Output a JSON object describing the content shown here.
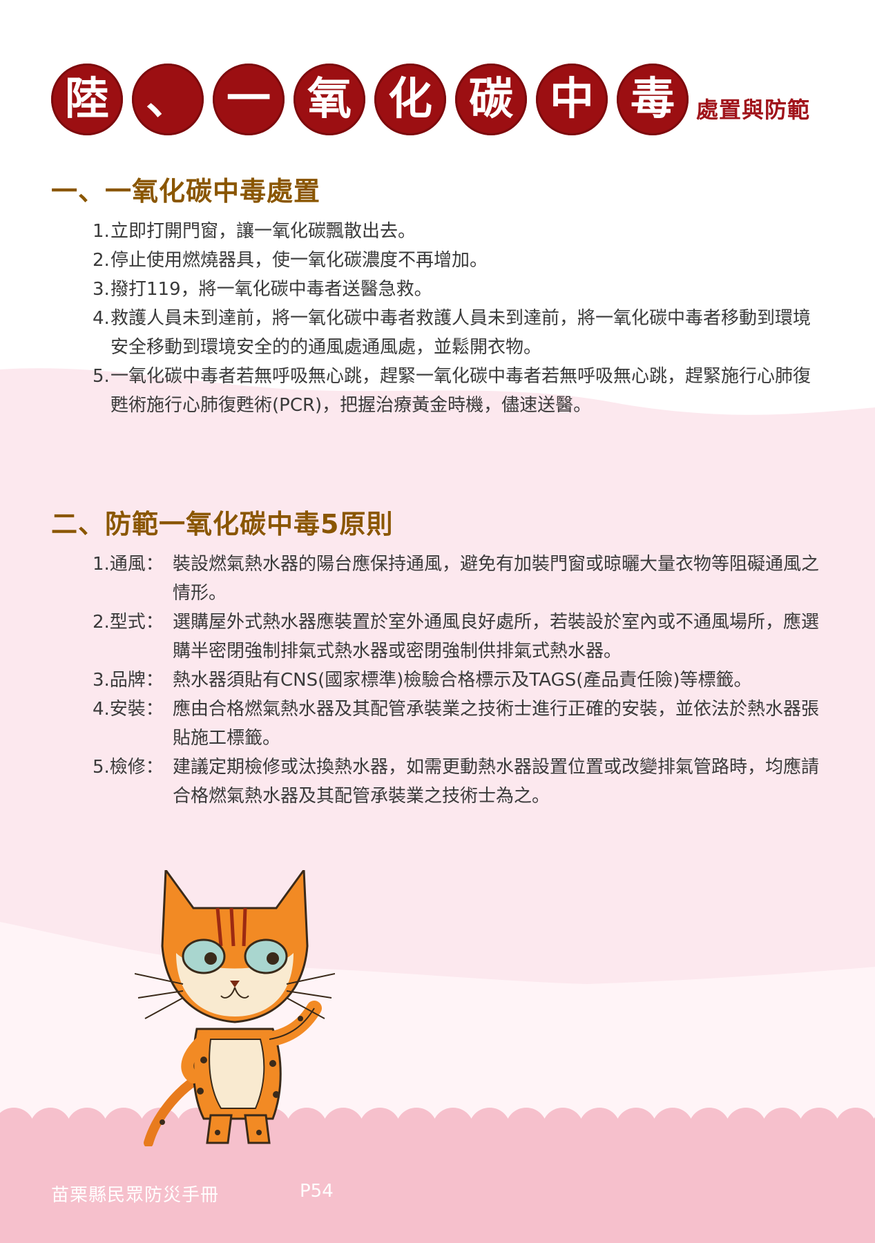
{
  "title": {
    "chars": [
      "陸",
      "、",
      "一",
      "氧",
      "化",
      "碳",
      "中",
      "毒"
    ],
    "subtitle": "處置與防範"
  },
  "section1": {
    "heading": "一、一氧化碳中毒處置",
    "items": [
      {
        "num": "1.",
        "text": "立即打開門窗，讓一氧化碳飄散出去。"
      },
      {
        "num": "2.",
        "text": "停止使用燃燒器具，使一氧化碳濃度不再增加。"
      },
      {
        "num": "3.",
        "text": "撥打119，將一氧化碳中毒者送醫急救。"
      },
      {
        "num": "4.",
        "text": "救護人員未到達前，將一氧化碳中毒者救護人員未到達前，將一氧化碳中毒者移動到環境安全移動到環境安全的的通風處通風處，並鬆開衣物。"
      },
      {
        "num": "5.",
        "text": "一氧化碳中毒者若無呼吸無心跳，趕緊一氧化碳中毒者若無呼吸無心跳，趕緊施行心肺復甦術施行心肺復甦術(PCR)，把握治療黃金時機，儘速送醫。"
      }
    ]
  },
  "section2": {
    "heading": "二、防範一氧化碳中毒5原則",
    "items": [
      {
        "num": "1.通風：",
        "text": "裝設燃氣熱水器的陽台應保持通風，避免有加裝門窗或晾曬大量衣物等阻礙通風之情形。"
      },
      {
        "num": "2.型式：",
        "text": "選購屋外式熱水器應裝置於室外通風良好處所，若裝設於室內或不通風場所，應選購半密閉強制排氣式熱水器或密閉強制供排氣式熱水器。"
      },
      {
        "num": "3.品牌：",
        "text": "熱水器須貼有CNS(國家標準)檢驗合格標示及TAGS(產品責任險)等標籤。"
      },
      {
        "num": "4.安裝：",
        "text": "應由合格燃氣熱水器及其配管承裝業之技術士進行正確的安裝，並依法於熱水器張貼施工標籤。"
      },
      {
        "num": "5.檢修：",
        "text": "建議定期檢修或汰換熱水器，如需更動熱水器設置位置或改變排氣管路時，均應請合格燃氣熱水器及其配管承裝業之技術士為之。"
      }
    ]
  },
  "footer": {
    "text": "苗栗縣民眾防災手冊",
    "page": "P54"
  },
  "colors": {
    "title_circle": "#9c0f12",
    "heading": "#8a5600",
    "pink_light": "#fce8ee",
    "pink_footer": "#f6c0cc"
  }
}
